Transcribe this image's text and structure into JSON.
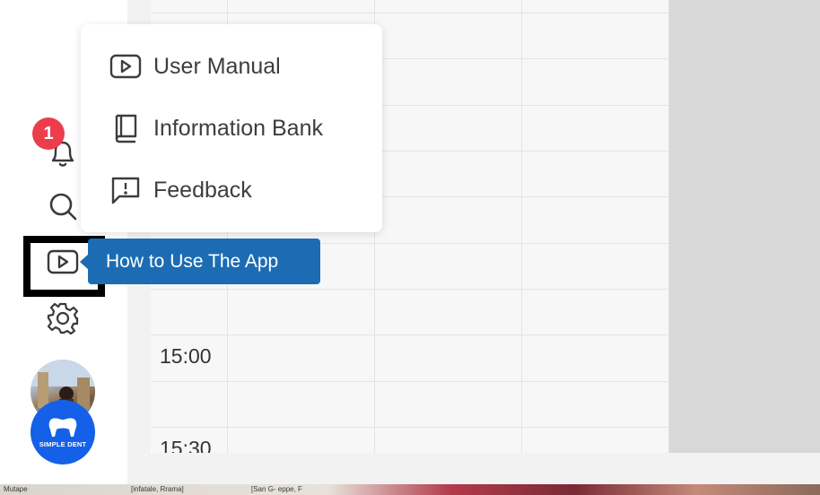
{
  "menu": {
    "items": [
      {
        "label": "User Manual",
        "icon": "play-video-icon"
      },
      {
        "label": "Information Bank",
        "icon": "book-icon"
      },
      {
        "label": "Feedback",
        "icon": "feedback-icon"
      }
    ]
  },
  "tooltip": {
    "label": "How to Use The App"
  },
  "notifications": {
    "count": "1",
    "badge_color": "#ec3d4d"
  },
  "calendar": {
    "times": [
      "15:00",
      "15:30"
    ]
  },
  "logo": {
    "text": "SIMPLE DENT",
    "color": "#1560e8"
  },
  "bottom_strip": {
    "texts": [
      "Mutape",
      "[infatale, Rrama]",
      "[San G-  eppe, F"
    ]
  },
  "colors": {
    "accent": "#1c6cb4",
    "highlight": "#000000"
  }
}
